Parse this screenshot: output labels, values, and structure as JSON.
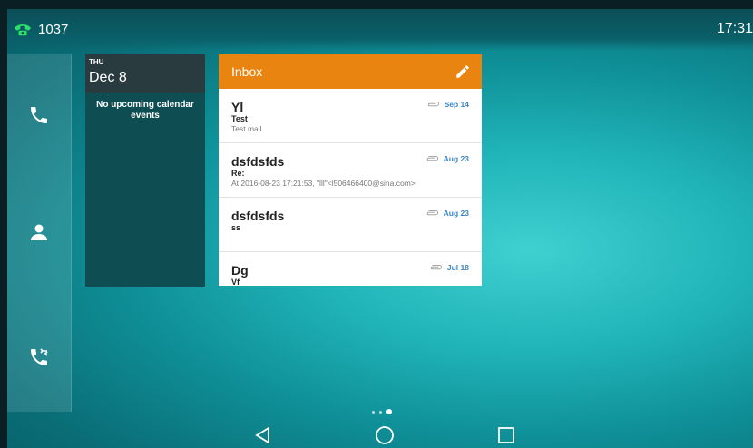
{
  "status": {
    "line_number": "1037",
    "time": "17:31",
    "line_icon": "phone-registered-icon"
  },
  "sidebar": {
    "items": [
      {
        "name": "call-icon"
      },
      {
        "name": "contacts-icon"
      },
      {
        "name": "call-history-icon"
      }
    ]
  },
  "calendar": {
    "day_of_week": "THU",
    "date": "Dec 8",
    "empty_text": "No upcoming calendar events"
  },
  "inbox": {
    "title": "Inbox",
    "edit_icon": "pencil-icon",
    "messages": [
      {
        "from": "Yl",
        "subject": "Test",
        "snippet": "Test mail",
        "date": "Sep 14"
      },
      {
        "from": "dsfdsfds",
        "subject": "Re:",
        "snippet": "At 2016-08-23 17:21:53, \"lll\"<l506466400@sina.com>",
        "date": "Aug 23"
      },
      {
        "from": "dsfdsfds",
        "subject": "ss",
        "snippet": "",
        "date": "Aug 23"
      },
      {
        "from": "Dg",
        "subject": "Vf",
        "snippet": "",
        "date": "Jul 18"
      }
    ]
  },
  "page_indicator": {
    "count": 3,
    "active": 3
  },
  "navbar": {
    "back_icon": "back-triangle-icon",
    "home_icon": "home-circle-icon",
    "recents_icon": "recents-square-icon"
  },
  "colors": {
    "inbox_header": "#e8840f",
    "calendar_bg": "#0e4e53",
    "date_link": "#3a86c8"
  }
}
